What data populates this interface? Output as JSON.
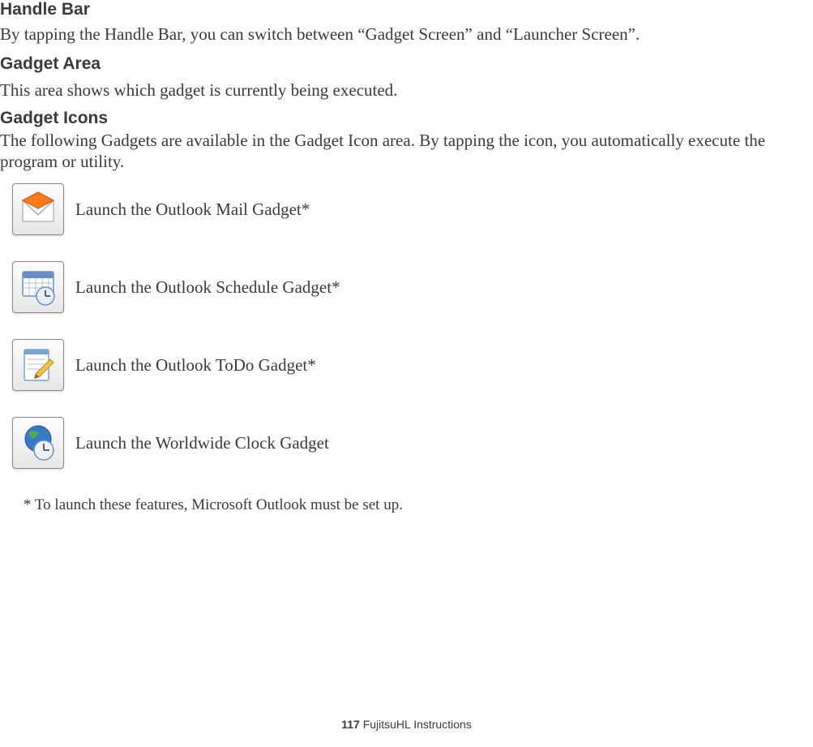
{
  "sections": {
    "handleBar": {
      "title": "Handle Bar",
      "body": "By tapping the Handle Bar, you can switch between “Gadget Screen” and “Launcher Screen”."
    },
    "gadgetArea": {
      "title": "Gadget Area",
      "body": "This area shows which gadget is currently being executed."
    },
    "gadgetIcons": {
      "title": "Gadget Icons",
      "body": "The following Gadgets are available in the Gadget Icon area. By tapping the icon, you automatically execute the program or utility."
    }
  },
  "icons": [
    {
      "name": "mail-icon",
      "label": "Launch the Outlook Mail Gadget*"
    },
    {
      "name": "calendar-icon",
      "label": "Launch the Outlook Schedule Gadget*"
    },
    {
      "name": "todo-icon",
      "label": "Launch the Outlook ToDo Gadget*"
    },
    {
      "name": "worldclock-icon",
      "label": "Launch the Worldwide Clock Gadget"
    }
  ],
  "footnote": "* To launch these features, Microsoft Outlook must be set up.",
  "footer": {
    "pageNumber": "117",
    "title": "FujitsuHL Instructions"
  }
}
